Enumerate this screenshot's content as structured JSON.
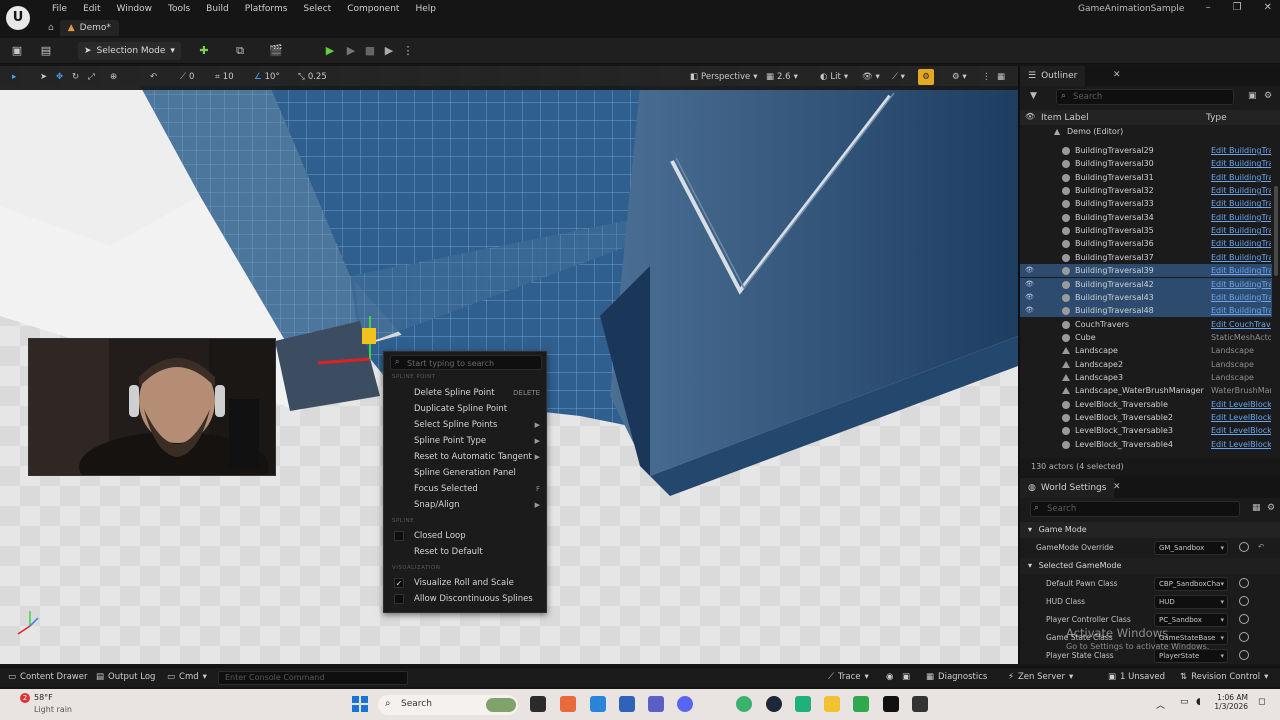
{
  "app": {
    "name": "GameAnimationSample",
    "document_tab": "Demo*",
    "menu": [
      "File",
      "Edit",
      "Window",
      "Tools",
      "Build",
      "Platforms",
      "Select",
      "Component",
      "Help"
    ]
  },
  "toolbar": {
    "mode": "Selection Mode"
  },
  "viewport": {
    "grid_snap": "10",
    "rotation_snap": "10°",
    "scale_snap": "0.25",
    "view_mode": "Perspective",
    "camera_speed": "2.6",
    "lighting": "Lit",
    "small_zero": "0"
  },
  "context_menu": {
    "search_placeholder": "Start typing to search",
    "section_spline_point": "SPLINE POINT",
    "section_spline": "SPLINE",
    "section_visualization": "VISUALIZATION",
    "items": [
      {
        "label": "Delete Spline Point",
        "shortcut": "DELETE"
      },
      {
        "label": "Duplicate Spline Point"
      },
      {
        "label": "Select Spline Points",
        "submenu": true
      },
      {
        "label": "Spline Point Type",
        "submenu": true
      },
      {
        "label": "Reset to Automatic Tangent",
        "submenu": true
      },
      {
        "label": "Spline Generation Panel"
      },
      {
        "label": "Focus Selected",
        "shortcut": "F"
      },
      {
        "label": "Snap/Align",
        "submenu": true
      }
    ],
    "spline_items": [
      {
        "label": "Closed Loop",
        "checked": false
      },
      {
        "label": "Reset to Default"
      }
    ],
    "visualization_items": [
      {
        "label": "Visualize Roll and Scale",
        "checked": true
      },
      {
        "label": "Allow Discontinuous Splines",
        "checked": false
      }
    ]
  },
  "outliner": {
    "title": "Outliner",
    "search_placeholder": "Search",
    "col_label": "Item Label",
    "col_type": "Type",
    "root": "Demo (Editor)",
    "rows": [
      {
        "label": "BuildingTraversal29",
        "type": "Edit BuildingTra",
        "link": true,
        "selected": false
      },
      {
        "label": "BuildingTraversal30",
        "type": "Edit BuildingTra",
        "link": true,
        "selected": false
      },
      {
        "label": "BuildingTraversal31",
        "type": "Edit BuildingTra",
        "link": true,
        "selected": false
      },
      {
        "label": "BuildingTraversal32",
        "type": "Edit BuildingTra",
        "link": true,
        "selected": false
      },
      {
        "label": "BuildingTraversal33",
        "type": "Edit BuildingTra",
        "link": true,
        "selected": false
      },
      {
        "label": "BuildingTraversal34",
        "type": "Edit BuildingTra",
        "link": true,
        "selected": false
      },
      {
        "label": "BuildingTraversal35",
        "type": "Edit BuildingTra",
        "link": true,
        "selected": false
      },
      {
        "label": "BuildingTraversal36",
        "type": "Edit BuildingTra",
        "link": true,
        "selected": false
      },
      {
        "label": "BuildingTraversal37",
        "type": "Edit BuildingTra",
        "link": true,
        "selected": false
      },
      {
        "label": "BuildingTraversal39",
        "type": "Edit BuildingTra",
        "link": true,
        "selected": true
      },
      {
        "label": "BuildingTraversal42",
        "type": "Edit BuildingTra",
        "link": true,
        "selected": true
      },
      {
        "label": "BuildingTraversal43",
        "type": "Edit BuildingTra",
        "link": true,
        "selected": true
      },
      {
        "label": "BuildingTraversal48",
        "type": "Edit BuildingTra",
        "link": true,
        "selected": true
      },
      {
        "label": "CouchTravers",
        "type": "Edit CouchTrave",
        "link": true,
        "selected": false
      },
      {
        "label": "Cube",
        "type": "StaticMeshActo",
        "link": false,
        "selected": false
      },
      {
        "label": "Landscape",
        "type": "Landscape",
        "link": false,
        "selected": false
      },
      {
        "label": "Landscape2",
        "type": "Landscape",
        "link": false,
        "selected": false
      },
      {
        "label": "Landscape3",
        "type": "Landscape",
        "link": false,
        "selected": false
      },
      {
        "label": "Landscape_WaterBrushManager",
        "type": "WaterBrushMan",
        "link": false,
        "selected": false
      },
      {
        "label": "LevelBlock_Traversable",
        "type": "Edit LevelBlock",
        "link": true,
        "selected": false
      },
      {
        "label": "LevelBlock_Traversable2",
        "type": "Edit LevelBlock",
        "link": true,
        "selected": false
      },
      {
        "label": "LevelBlock_Traversable3",
        "type": "Edit LevelBlock",
        "link": true,
        "selected": false
      },
      {
        "label": "LevelBlock_Traversable4",
        "type": "Edit LevelBlock",
        "link": true,
        "selected": false
      }
    ],
    "status": "130 actors (4 selected)"
  },
  "world_settings": {
    "title": "World Settings",
    "search_placeholder": "Search",
    "category_game_mode": "Game Mode",
    "game_mode_override_label": "GameMode Override",
    "game_mode_override_value": "GM_Sandbox",
    "category_selected": "Selected GameMode",
    "rows": [
      {
        "label": "Default Pawn Class",
        "value": "CBP_SandboxCha"
      },
      {
        "label": "HUD Class",
        "value": "HUD"
      },
      {
        "label": "Player Controller Class",
        "value": "PC_Sandbox"
      },
      {
        "label": "Game State Class",
        "value": "GameStateBase"
      },
      {
        "label": "Player State Class",
        "value": "PlayerState"
      }
    ]
  },
  "bottom_bar": {
    "content_drawer": "Content Drawer",
    "output_log": "Output Log",
    "cmd": "Cmd",
    "console_placeholder": "Enter Console Command",
    "trace": "Trace",
    "diagnostics": "Diagnostics",
    "zen_server": "Zen Server",
    "unsaved": "1 Unsaved",
    "revision_control": "Revision Control"
  },
  "watermark": {
    "line1": "Activate Windows",
    "line2": "Go to Settings to activate Windows."
  },
  "taskbar": {
    "weather_temp": "58°F",
    "weather_desc": "Light rain",
    "weather_badge": "2",
    "search": "Search",
    "time": "1:06 AM",
    "date": "1/3/2026"
  }
}
